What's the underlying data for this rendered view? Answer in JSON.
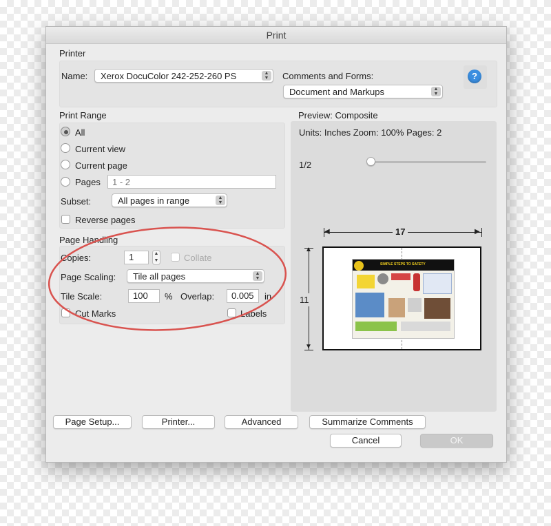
{
  "window": {
    "title": "Print"
  },
  "printer": {
    "section_label": "Printer",
    "name_label": "Name:",
    "name_value": "Xerox DocuColor 242-252-260 PS",
    "comments_label": "Comments and Forms:",
    "comments_value": "Document and Markups",
    "help_glyph": "?"
  },
  "print_range": {
    "section_label": "Print Range",
    "all_label": "All",
    "current_view_label": "Current view",
    "current_page_label": "Current page",
    "pages_label": "Pages",
    "pages_placeholder": "1 - 2",
    "subset_label": "Subset:",
    "subset_value": "All pages in range",
    "reverse_label": "Reverse pages"
  },
  "page_handling": {
    "section_label": "Page Handling",
    "copies_label": "Copies:",
    "copies_value": "1",
    "collate_label": "Collate",
    "scaling_label": "Page Scaling:",
    "scaling_value": "Tile all pages",
    "tile_scale_label": "Tile Scale:",
    "tile_scale_value": "100",
    "tile_scale_unit": "%",
    "overlap_label": "Overlap:",
    "overlap_value": "0.005",
    "overlap_unit": "in",
    "cut_marks_label": "Cut Marks",
    "labels_label": "Labels"
  },
  "preview": {
    "section_label": "Preview: Composite",
    "info": "Units: Inches Zoom: 100% Pages: 2",
    "page_indicator": "1/2",
    "width_dim": "17",
    "height_dim": "11",
    "thumb_headline": "SIMPLE STEPS TO SAFETY"
  },
  "buttons": {
    "page_setup": "Page Setup...",
    "printer": "Printer...",
    "advanced": "Advanced",
    "summarize": "Summarize Comments",
    "cancel": "Cancel",
    "ok": "OK"
  },
  "colors": {
    "annotation_circle": "#d9534f",
    "help_button": "#3b8ee0"
  }
}
